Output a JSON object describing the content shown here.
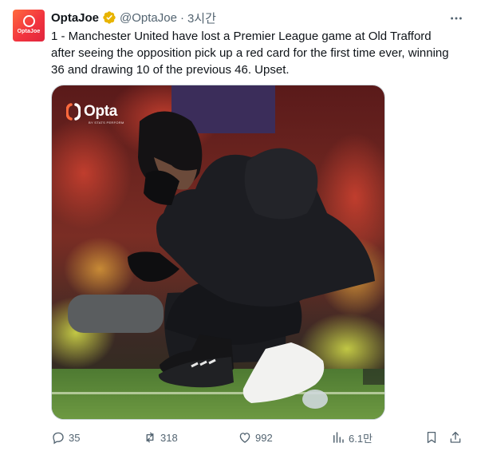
{
  "author": {
    "name": "OptaJoe",
    "handle": "@OptaJoe",
    "separator": "·",
    "time": "3시간",
    "avatar_text": "OptaJoe"
  },
  "tweet": {
    "text": "1 - Manchester United have lost a Premier League game at Old Trafford\nafter seeing the opposition pick up a red card for the first time ever, winning\n36 and drawing 10 of the previous 46. Upset."
  },
  "media": {
    "logo_text": "Opta",
    "logo_sub": "BY STATS PERFORM"
  },
  "actions": {
    "replies": "35",
    "retweets": "318",
    "likes": "992",
    "views": "6.1만"
  },
  "colors": {
    "verified": "#e8b400",
    "muted": "#536471",
    "brand": "#f2353f"
  }
}
